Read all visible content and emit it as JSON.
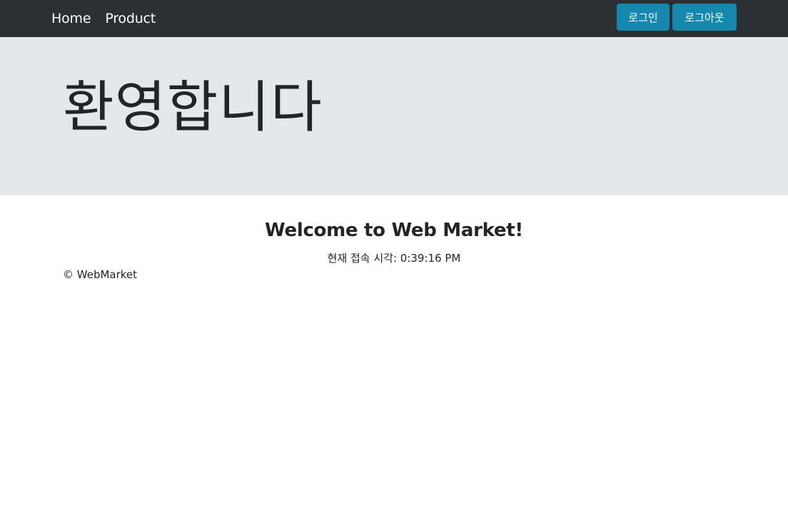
{
  "navbar": {
    "links": [
      "Home",
      "Product"
    ],
    "login_label": "로그인",
    "logout_label": "로그아웃"
  },
  "jumbotron": {
    "title": "환영합니다"
  },
  "main": {
    "welcome": "Welcome to Web Market!",
    "time_label": "현재 접속 시각: ",
    "time_value": "0:39:16 PM"
  },
  "footer": {
    "copyright": "© WebMarket"
  },
  "colors": {
    "navbar_bg": "#2b3035",
    "button_bg": "#1688ad",
    "jumbotron_bg": "#e4e8ea"
  }
}
